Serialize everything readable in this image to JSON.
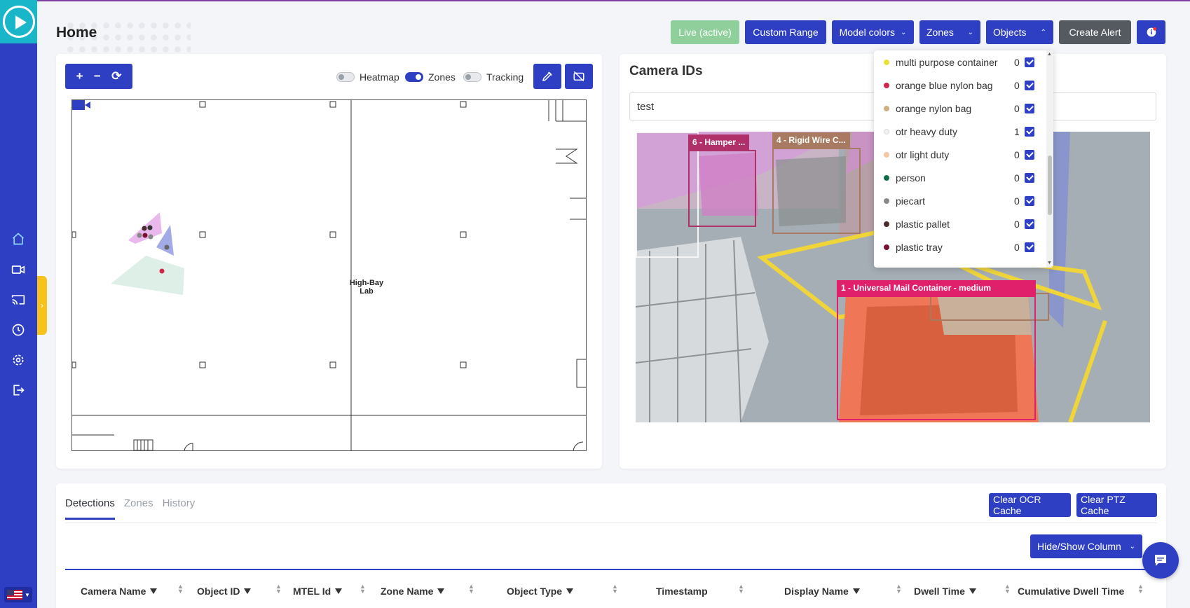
{
  "header": {
    "title": "Home",
    "buttons": {
      "live": "Live (active)",
      "custom_range": "Custom Range",
      "model_colors": "Model colors",
      "zones": "Zones",
      "objects": "Objects",
      "create_alert": "Create Alert"
    }
  },
  "map": {
    "toggles": {
      "heatmap": "Heatmap",
      "zones": "Zones",
      "tracking": "Tracking"
    },
    "toggle_state": {
      "heatmap": false,
      "zones": true,
      "tracking": false
    },
    "label_line1": "High-Bay",
    "label_line2": "Lab"
  },
  "camera": {
    "title": "Camera IDs",
    "search_value": "test",
    "detections": [
      {
        "label": "6 - Hamper ...",
        "color": "#b0306a"
      },
      {
        "label": "4 - Rigid Wire C...",
        "color": "#a87a62"
      },
      {
        "label": "1 - Universal Mail Container - medium",
        "color": "#e0206a"
      }
    ]
  },
  "objects_dropdown": {
    "items": [
      {
        "label": "multi purpose container",
        "count": "0",
        "color": "#e8e23a",
        "checked": true
      },
      {
        "label": "orange blue nylon bag",
        "count": "0",
        "color": "#d0254a",
        "checked": true
      },
      {
        "label": "orange nylon bag",
        "count": "0",
        "color": "#cfae80",
        "checked": true
      },
      {
        "label": "otr heavy duty",
        "count": "1",
        "color": "#f1f1f1",
        "checked": true
      },
      {
        "label": "otr light duty",
        "count": "0",
        "color": "#f2c7a4",
        "checked": true
      },
      {
        "label": "person",
        "count": "0",
        "color": "#0f6e48",
        "checked": true
      },
      {
        "label": "piecart",
        "count": "0",
        "color": "#8a8a8a",
        "checked": true
      },
      {
        "label": "plastic pallet",
        "count": "0",
        "color": "#4a2a2a",
        "checked": true
      },
      {
        "label": "plastic tray",
        "count": "0",
        "color": "#7a1030",
        "checked": true
      }
    ]
  },
  "bottom": {
    "tabs": [
      "Detections",
      "Zones",
      "History"
    ],
    "active_tab": "Detections",
    "clear_ocr": "Clear OCR Cache",
    "clear_ptz": "Clear PTZ Cache",
    "hide_show": "Hide/Show Column",
    "columns": [
      "Camera Name",
      "Object ID",
      "MTEL Id",
      "Zone Name",
      "Object Type",
      "Timestamp",
      "Display Name",
      "Dwell Time",
      "Cumulative Dwell Time"
    ]
  },
  "colors": {
    "primary": "#2f3fc4",
    "live": "#8ecf9b",
    "sidebar": "#2f3fc4",
    "logo": "#19b6c9",
    "accent_tab": "#f6c21b"
  }
}
